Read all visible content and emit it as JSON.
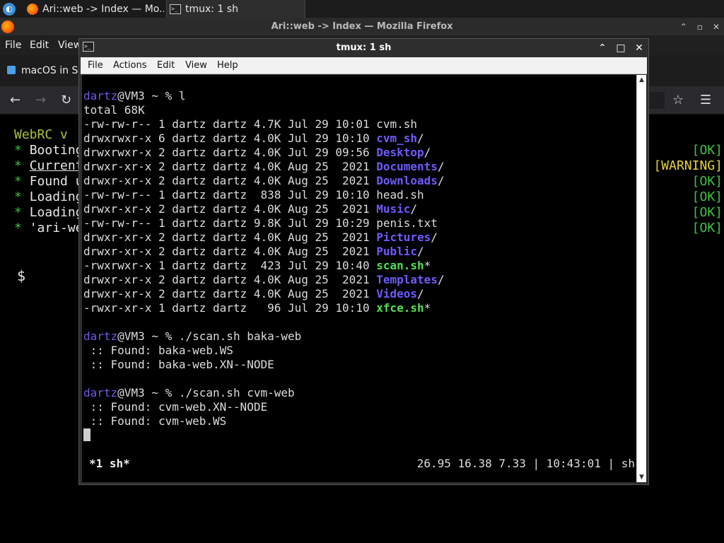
{
  "taskbar": {
    "tasks": [
      {
        "label": "Ari::web -> Index — Mo...",
        "icon": "firefox-icon"
      },
      {
        "label": "tmux: 1 sh",
        "icon": "terminal-icon"
      }
    ]
  },
  "firefox": {
    "title": "Ari::web -> Index — Mozilla Firefox",
    "menu": [
      "File",
      "Edit",
      "View"
    ],
    "tab_label": "macOS in Sv",
    "console": {
      "header": "WebRC v",
      "lines": [
        {
          "bullet": "*",
          "text": "Booting",
          "status": "[OK]"
        },
        {
          "bullet": "*",
          "text": "Current",
          "status": "[WARNING]"
        },
        {
          "bullet": "*",
          "text": "Found u",
          "status": "[OK]"
        },
        {
          "bullet": "*",
          "text": "Loading",
          "status": "[OK]"
        },
        {
          "bullet": "*",
          "text": "Loading",
          "status": "[OK]"
        },
        {
          "bullet": "*",
          "text": "'ari-we",
          "status": "[OK]"
        }
      ],
      "prompt": "$"
    }
  },
  "tmux_window": {
    "title": "tmux: 1 sh",
    "menu": [
      "File",
      "Actions",
      "Edit",
      "View",
      "Help"
    ],
    "colors": {
      "user": "#6a5ae6",
      "dir": "#6e5bff",
      "exe": "#4ee44e"
    },
    "prompt": {
      "user": "dartz",
      "rest": "@VM3 ~ % "
    },
    "commands": {
      "ls": "l",
      "scan1": "./scan.sh baka-web",
      "scan2": "./scan.sh cvm-web"
    },
    "total": "total 68K",
    "listing": [
      {
        "meta": "-rw-rw-r-- 1 dartz dartz 4.7K Jul 29 10:01 ",
        "name": "cvm.sh",
        "type": "file",
        "suffix": ""
      },
      {
        "meta": "drwxrwxr-x 6 dartz dartz 4.0K Jul 29 10:10 ",
        "name": "cvm_sh",
        "type": "dir",
        "suffix": "/"
      },
      {
        "meta": "drwxrwxr-x 2 dartz dartz 4.0K Jul 29 09:56 ",
        "name": "Desktop",
        "type": "dir",
        "suffix": "/"
      },
      {
        "meta": "drwxr-xr-x 2 dartz dartz 4.0K Aug 25  2021 ",
        "name": "Documents",
        "type": "dir",
        "suffix": "/"
      },
      {
        "meta": "drwxr-xr-x 2 dartz dartz 4.0K Aug 25  2021 ",
        "name": "Downloads",
        "type": "dir",
        "suffix": "/"
      },
      {
        "meta": "-rw-rw-r-- 1 dartz dartz  838 Jul 29 10:10 ",
        "name": "head.sh",
        "type": "file",
        "suffix": ""
      },
      {
        "meta": "drwxr-xr-x 2 dartz dartz 4.0K Aug 25  2021 ",
        "name": "Music",
        "type": "dir",
        "suffix": "/"
      },
      {
        "meta": "-rw-rw-r-- 1 dartz dartz 9.8K Jul 29 10:29 ",
        "name": "penis.txt",
        "type": "file",
        "suffix": ""
      },
      {
        "meta": "drwxr-xr-x 2 dartz dartz 4.0K Aug 25  2021 ",
        "name": "Pictures",
        "type": "dir",
        "suffix": "/"
      },
      {
        "meta": "drwxr-xr-x 2 dartz dartz 4.0K Aug 25  2021 ",
        "name": "Public",
        "type": "dir",
        "suffix": "/"
      },
      {
        "meta": "-rwxrwxr-x 1 dartz dartz  423 Jul 29 10:40 ",
        "name": "scan.sh",
        "type": "exe",
        "suffix": "*"
      },
      {
        "meta": "drwxr-xr-x 2 dartz dartz 4.0K Aug 25  2021 ",
        "name": "Templates",
        "type": "dir",
        "suffix": "/"
      },
      {
        "meta": "drwxr-xr-x 2 dartz dartz 4.0K Aug 25  2021 ",
        "name": "Videos",
        "type": "dir",
        "suffix": "/"
      },
      {
        "meta": "-rwxr-xr-x 1 dartz dartz   96 Jul 29 10:10 ",
        "name": "xfce.sh",
        "type": "exe",
        "suffix": "*"
      }
    ],
    "scan1_results": [
      " :: Found: baka-web.WS",
      " :: Found: baka-web.XN--NODE"
    ],
    "scan2_results": [
      " :: Found: cvm-web.XN--NODE",
      " :: Found: cvm-web.WS"
    ],
    "status_left": "*1 sh*",
    "status_right": "26.95 16.38 7.33 | 10:43:01 | sh"
  }
}
